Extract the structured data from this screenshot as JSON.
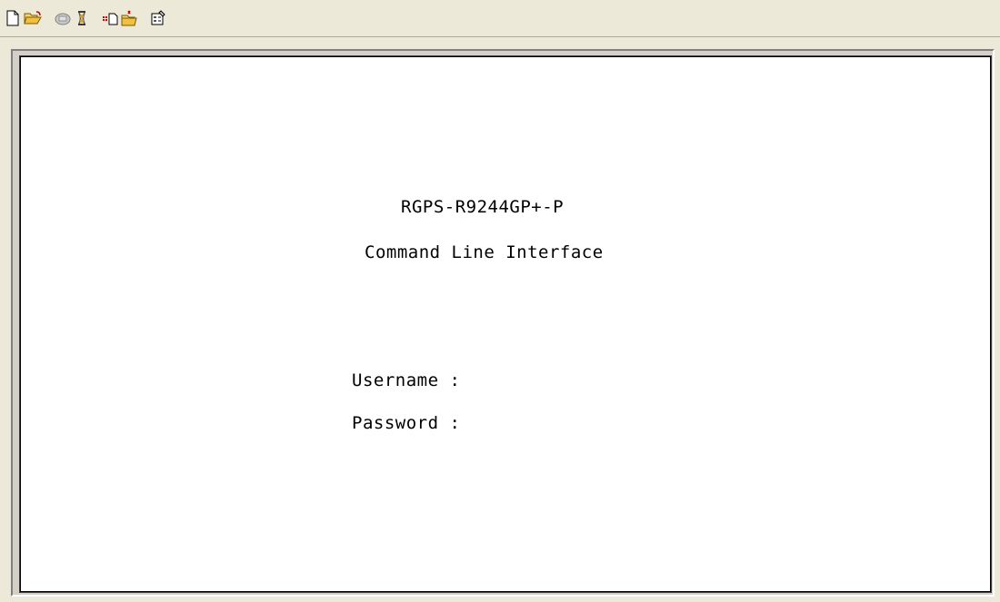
{
  "toolbar": {
    "buttons": [
      {
        "name": "new-icon"
      },
      {
        "name": "open-icon"
      },
      {
        "name": "connect-icon"
      },
      {
        "name": "disconnect-icon"
      },
      {
        "name": "send-icon"
      },
      {
        "name": "receive-icon"
      },
      {
        "name": "properties-icon"
      }
    ]
  },
  "terminal": {
    "device_name": "RGPS-R9244GP+-P",
    "subtitle": "Command Line Interface",
    "username_label": "Username :",
    "password_label": "Password :"
  }
}
